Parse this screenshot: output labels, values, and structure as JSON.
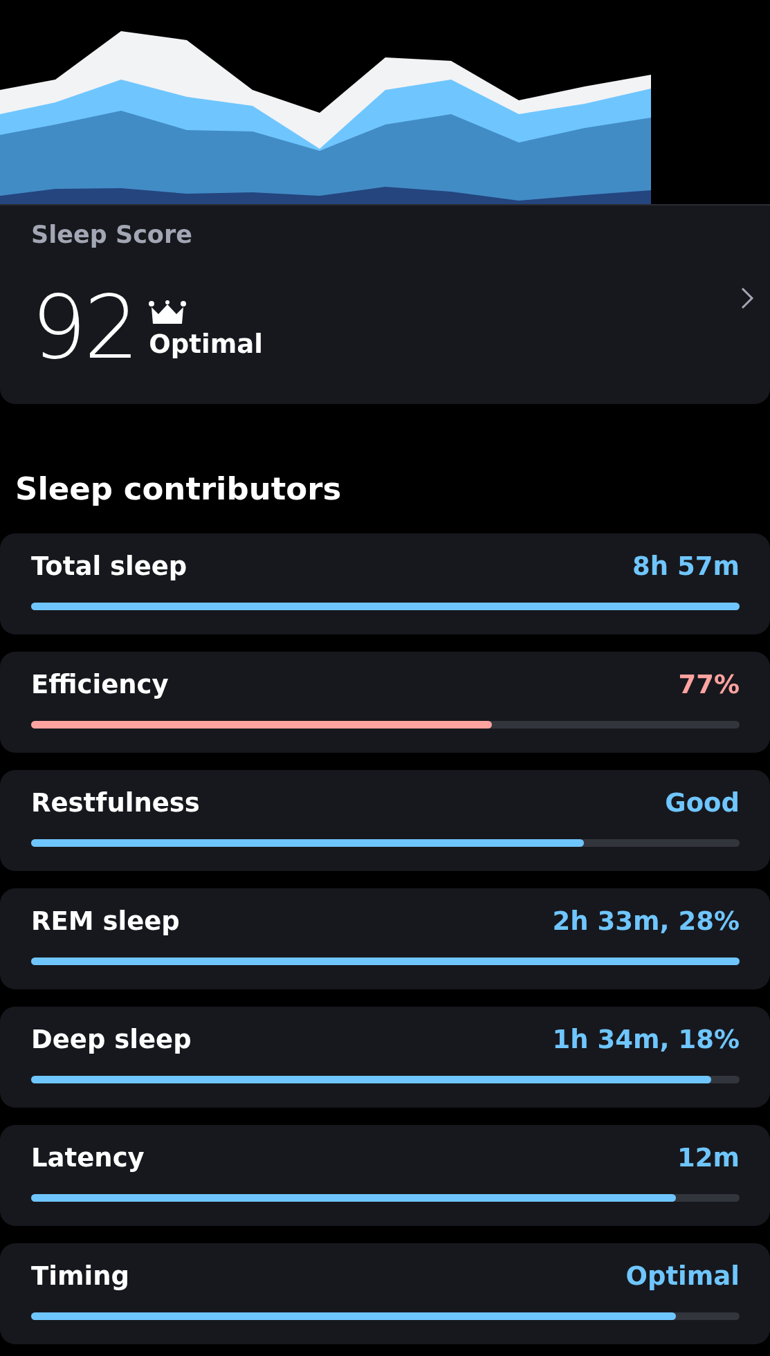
{
  "score_card": {
    "title": "Sleep Score",
    "score": "92",
    "rating": "Optimal"
  },
  "contributors_title": "Sleep contributors",
  "contributors": [
    {
      "label": "Total sleep",
      "value": "8h 57m",
      "level": 1.0,
      "color": "#6fc6ff"
    },
    {
      "label": "Efficiency",
      "value": "77%",
      "level": 0.65,
      "color": "#ffa3a0"
    },
    {
      "label": "Restfulness",
      "value": "Good",
      "level": 0.78,
      "color": "#6fc6ff"
    },
    {
      "label": "REM sleep",
      "value": "2h 33m, 28%",
      "level": 1.0,
      "color": "#6fc6ff"
    },
    {
      "label": "Deep sleep",
      "value": "1h 34m, 18%",
      "level": 0.96,
      "color": "#6fc6ff"
    },
    {
      "label": "Latency",
      "value": "12m",
      "level": 0.91,
      "color": "#6fc6ff"
    },
    {
      "label": "Timing",
      "value": "Optimal",
      "level": 0.91,
      "color": "#6fc6ff"
    }
  ]
}
